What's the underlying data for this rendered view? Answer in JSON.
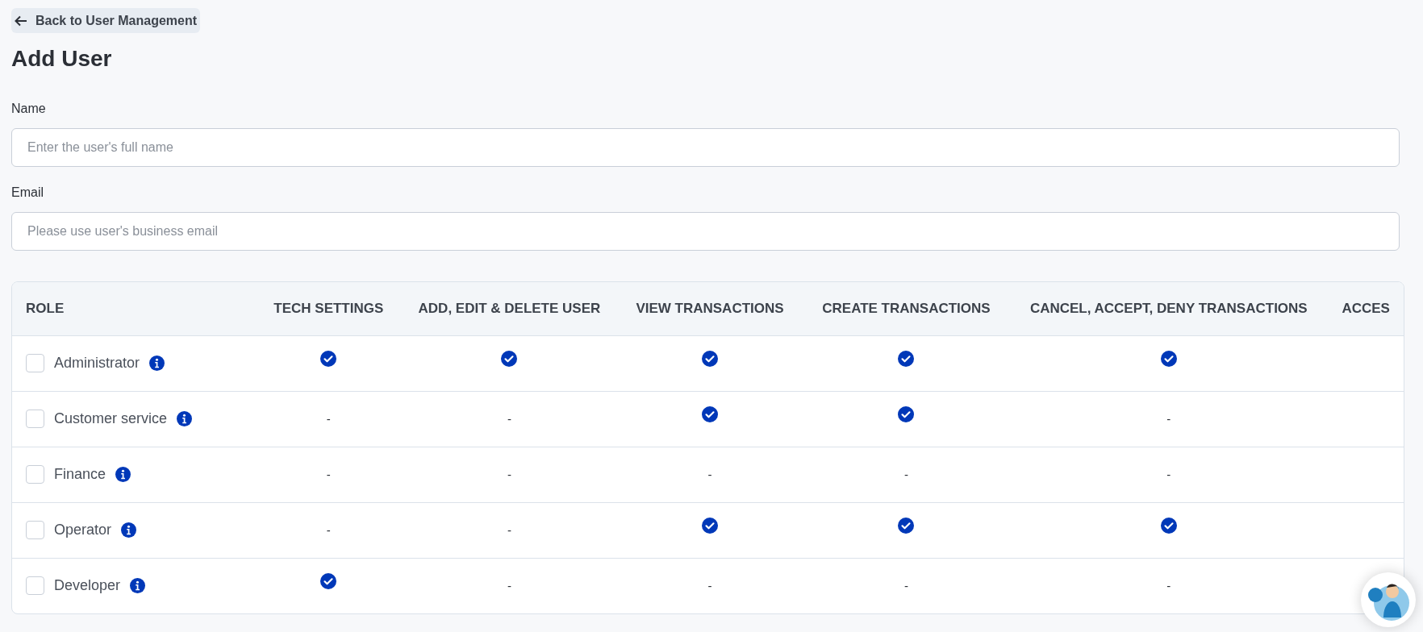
{
  "back_link": {
    "label": "Back to User Management"
  },
  "title": "Add User",
  "fields": [
    {
      "label": "Name",
      "placeholder": "Enter the user's full name"
    },
    {
      "label": "Email",
      "placeholder": "Please use user's business email"
    }
  ],
  "table": {
    "columns": [
      "ROLE",
      "TECH SETTINGS",
      "ADD, EDIT & DELETE USER",
      "VIEW TRANSACTIONS",
      "CREATE TRANSACTIONS",
      "CANCEL, ACCEPT, DENY TRANSACTIONS",
      "ACCES"
    ],
    "rows": [
      {
        "cells": [
          {
            "kind": "role",
            "text": "Administrator",
            "checked": false
          },
          {
            "kind": "check"
          },
          {
            "kind": "check"
          },
          {
            "kind": "check"
          },
          {
            "kind": "check"
          },
          {
            "kind": "check"
          }
        ]
      },
      {
        "cells": [
          {
            "kind": "role",
            "text": "Customer service",
            "checked": false
          },
          {
            "kind": "text",
            "text": "-"
          },
          {
            "kind": "text",
            "text": "-"
          },
          {
            "kind": "check"
          },
          {
            "kind": "check"
          },
          {
            "kind": "text",
            "text": "-"
          }
        ]
      },
      {
        "cells": [
          {
            "kind": "role",
            "text": "Finance",
            "checked": false
          },
          {
            "kind": "text",
            "text": "-"
          },
          {
            "kind": "text",
            "text": "-"
          },
          {
            "kind": "text",
            "text": "-"
          },
          {
            "kind": "text",
            "text": "-"
          },
          {
            "kind": "text",
            "text": "-"
          }
        ]
      },
      {
        "cells": [
          {
            "kind": "role",
            "text": "Operator",
            "checked": false
          },
          {
            "kind": "text",
            "text": "-"
          },
          {
            "kind": "text",
            "text": "-"
          },
          {
            "kind": "check"
          },
          {
            "kind": "check"
          },
          {
            "kind": "check"
          }
        ]
      },
      {
        "cells": [
          {
            "kind": "role",
            "text": "Developer",
            "checked": false
          },
          {
            "kind": "check"
          },
          {
            "kind": "text",
            "text": "-"
          },
          {
            "kind": "text",
            "text": "-"
          },
          {
            "kind": "text",
            "text": "-"
          },
          {
            "kind": "text",
            "text": "-"
          }
        ]
      }
    ]
  }
}
